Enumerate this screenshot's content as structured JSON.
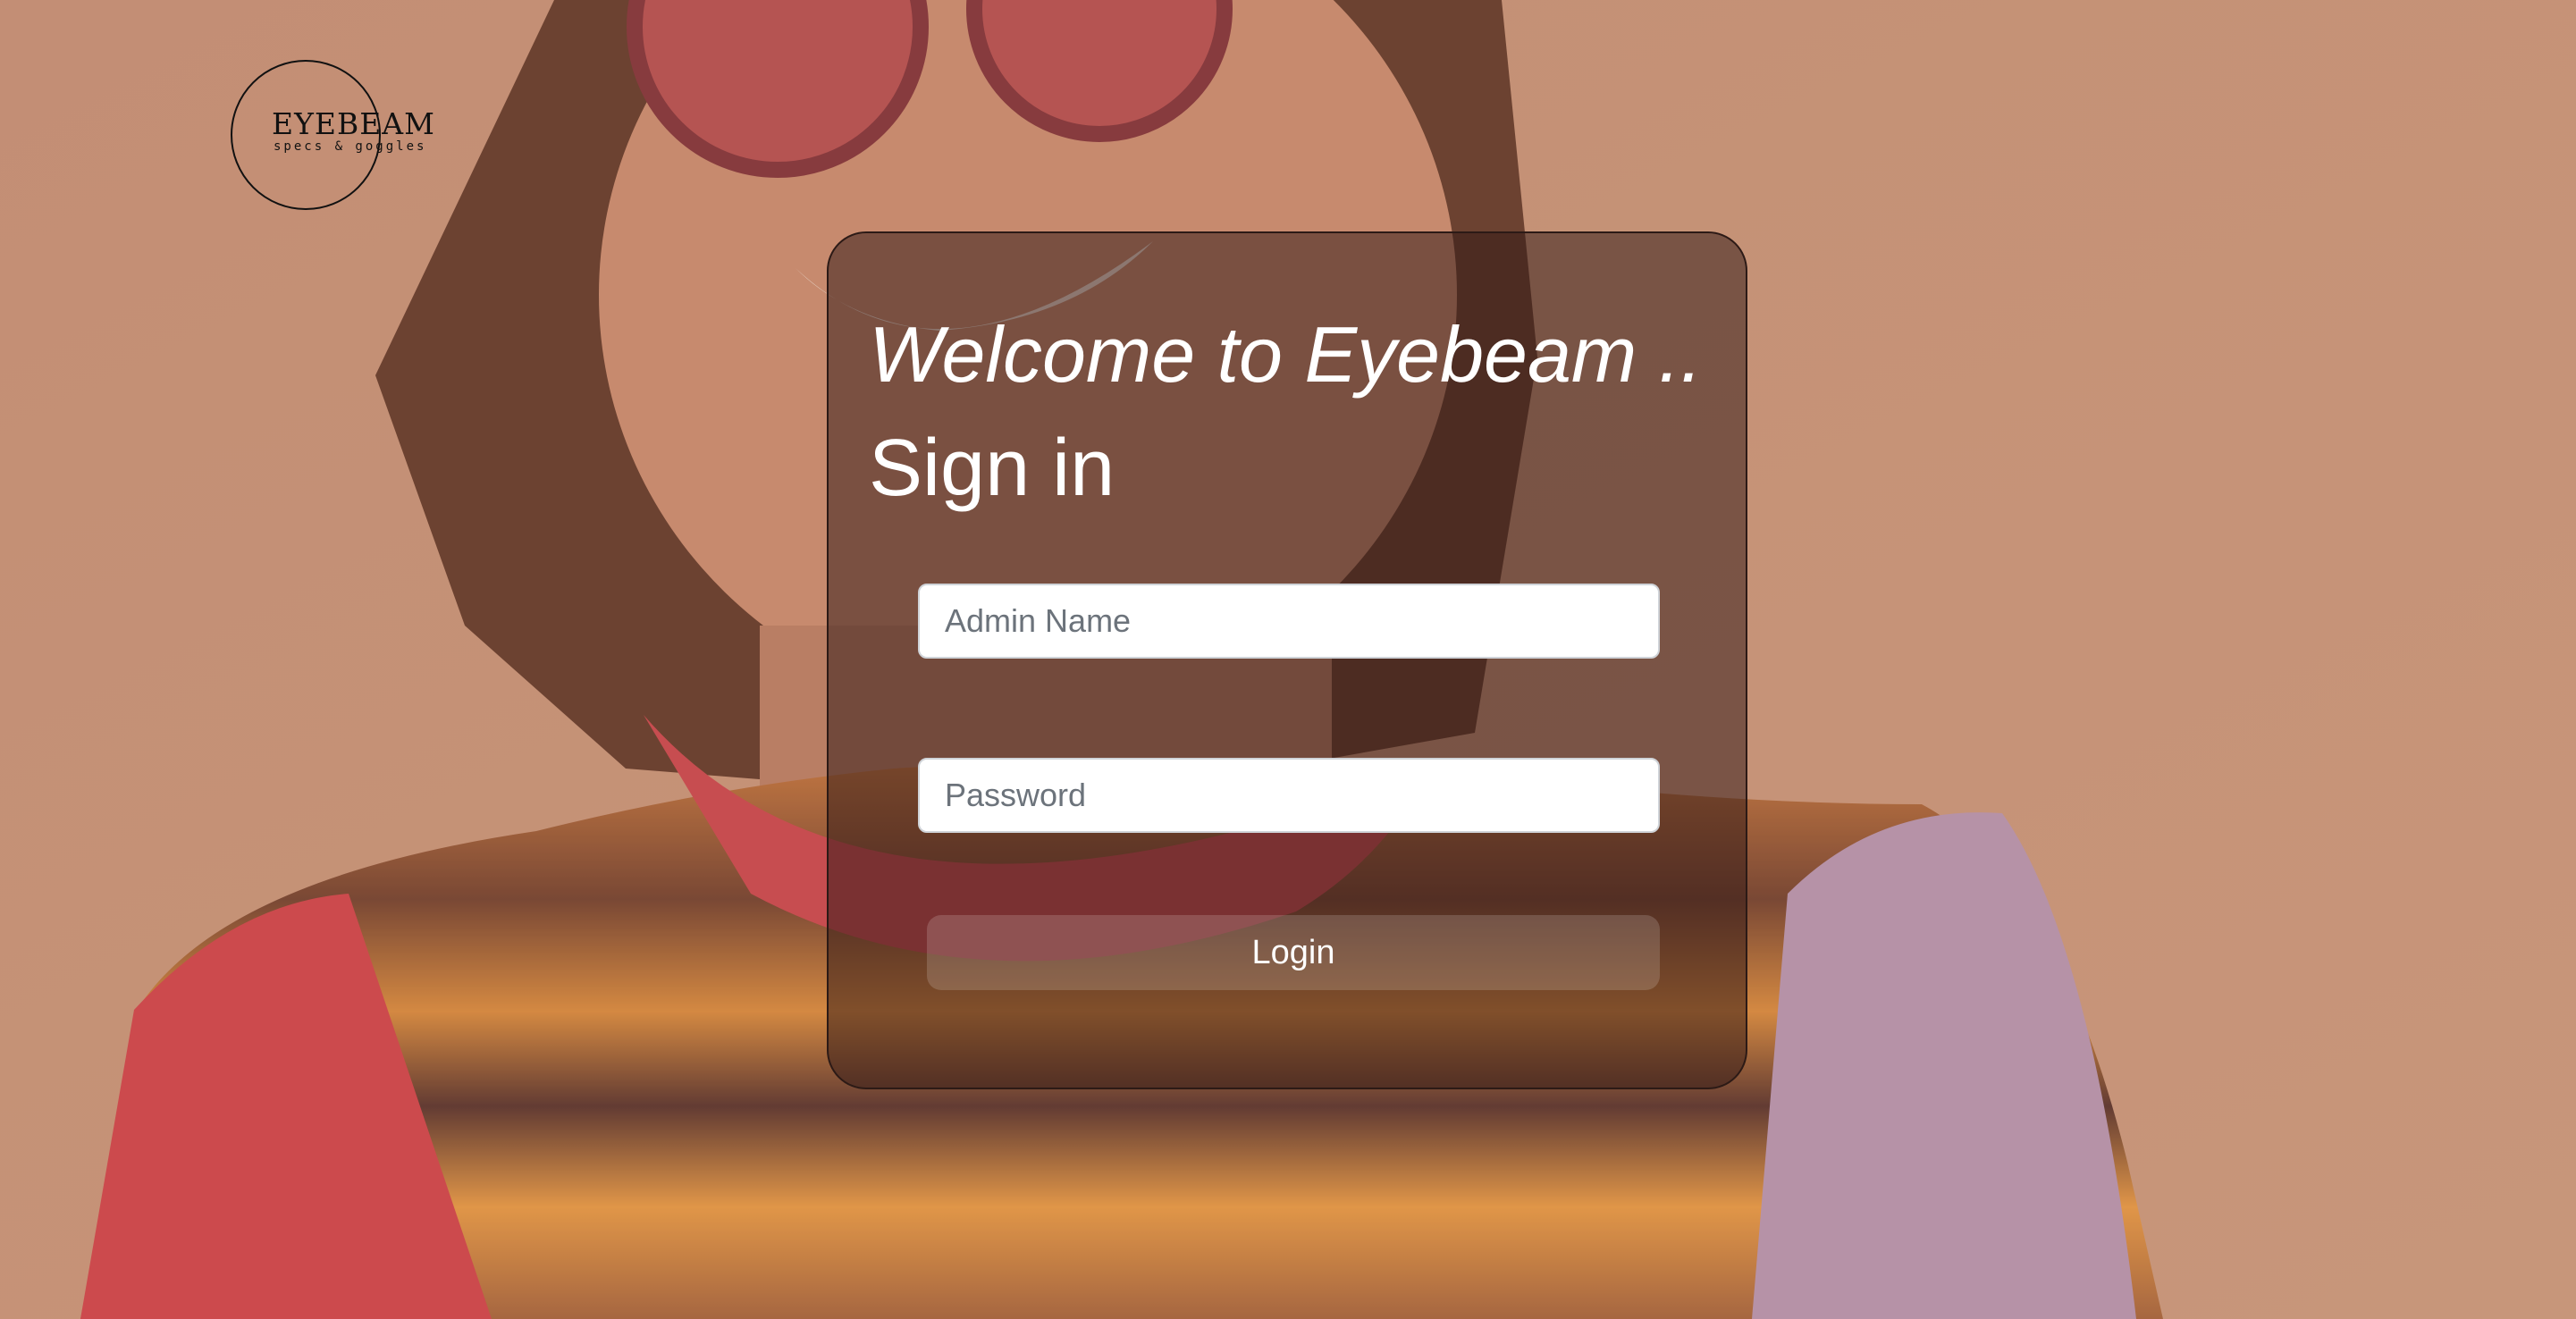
{
  "logo": {
    "name": "EYEBEAM",
    "tagline": "specs & goggles"
  },
  "login": {
    "welcome": "Welcome to Eyebeam ..",
    "title": "Sign in",
    "admin_name_placeholder": "Admin Name",
    "password_placeholder": "Password",
    "login_label": "Login"
  },
  "colors": {
    "background": "#c99a82",
    "card_tint": "#2d1614",
    "text": "#ffffff"
  }
}
